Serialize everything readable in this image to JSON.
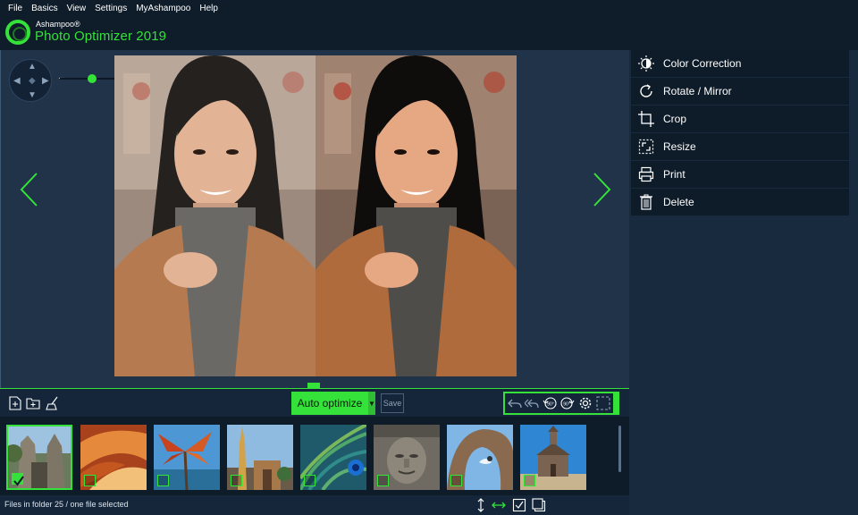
{
  "menu": [
    "File",
    "Basics",
    "View",
    "Settings",
    "MyAshampoo",
    "Help"
  ],
  "brand": {
    "company": "Ashampoo®",
    "product": "Photo Optimizer 2019",
    "accent": "#34e23a"
  },
  "tools": [
    {
      "label": "Color Correction",
      "icon": "color-correction-icon"
    },
    {
      "label": "Rotate / Mirror",
      "icon": "rotate-mirror-icon"
    },
    {
      "label": "Crop",
      "icon": "crop-icon"
    },
    {
      "label": "Resize",
      "icon": "resize-icon"
    },
    {
      "label": "Print",
      "icon": "print-icon"
    },
    {
      "label": "Delete",
      "icon": "trash-icon"
    }
  ],
  "toolbar": {
    "auto_optimize": "Auto optimize",
    "save": "Save"
  },
  "thumbnails": [
    {
      "subject": "temple-ruins",
      "selected": true
    },
    {
      "subject": "canyon",
      "selected": false
    },
    {
      "subject": "tropical-plant",
      "selected": false
    },
    {
      "subject": "pagoda-city",
      "selected": false
    },
    {
      "subject": "peacock-feathers",
      "selected": false
    },
    {
      "subject": "stone-face",
      "selected": false
    },
    {
      "subject": "tree-arch-bird",
      "selected": false
    },
    {
      "subject": "chapel",
      "selected": false
    }
  ],
  "status": {
    "text": "Files in folder 25 / one file selected"
  }
}
